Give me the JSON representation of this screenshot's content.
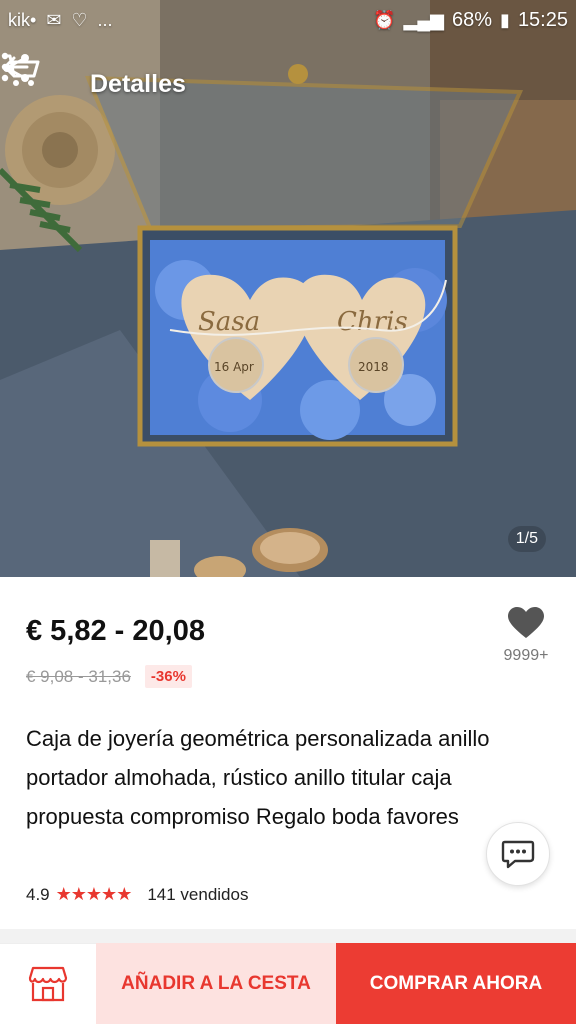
{
  "status_bar": {
    "left_icons": [
      "kik-icon",
      "mail-icon",
      "heart-outline-icon"
    ],
    "left_text": "kik•",
    "ellipsis": "...",
    "battery": "68%",
    "time": "15:25"
  },
  "header": {
    "title": "Detalles",
    "back_icon": "arrow-left-icon",
    "cart_icon": "cart-icon",
    "share_icon": "share-icon",
    "more_icon": "more-vertical-icon"
  },
  "gallery": {
    "counter": "1/5",
    "photo_texts": [
      "Sasa",
      "Chris",
      "16 Apr",
      "2018"
    ]
  },
  "product": {
    "price": "€ 5,82 - 20,08",
    "original_price": "€ 9,08 - 31,36",
    "discount": "-36%",
    "wishlist_count": "9999+",
    "title": "Caja de joyería geométrica personalizada anillo portador almohada, rústico anillo titular caja propuesta compromiso Regalo boda favores",
    "rating": "4.9",
    "stars": "★★★★★",
    "sold": "141 vendidos"
  },
  "actions": {
    "store_icon": "store-icon",
    "add_to_cart": "AÑADIR A LA CESTA",
    "buy_now": "COMPRAR AHORA"
  },
  "colors": {
    "accent": "#ec3c33",
    "accent_light": "#fde2e0",
    "star": "#e8372f"
  }
}
